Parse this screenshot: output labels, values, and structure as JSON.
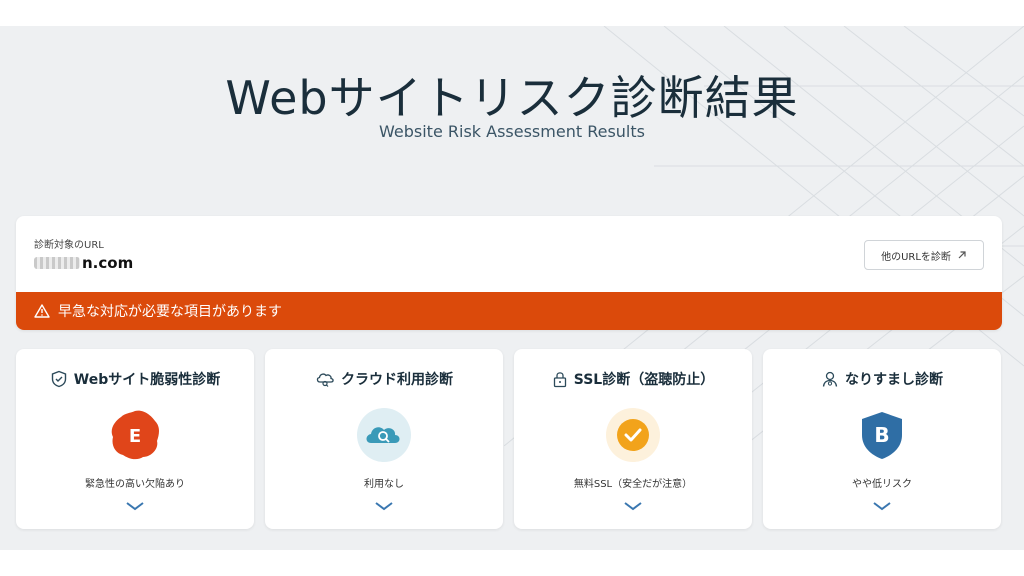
{
  "header": {
    "title": "Webサイトリスク診断結果",
    "subtitle": "Website Risk Assessment Results"
  },
  "target": {
    "label": "診断対象のURL",
    "url_visible": "n.com",
    "other_url_button": "他のURLを診断"
  },
  "alert": {
    "text": "早急な対応が必要な項目があります",
    "color": "#db4a0b"
  },
  "cards": [
    {
      "title": "Webサイト脆弱性診断",
      "icon": "shield-icon",
      "grade": "E",
      "status": "緊急性の高い欠陥あり",
      "grade_color": "#e0451a"
    },
    {
      "title": "クラウド利用診断",
      "icon": "cloud-search-icon",
      "grade": "",
      "status": "利用なし",
      "grade_color": "#3a9ab8"
    },
    {
      "title": "SSL診断（盗聴防止）",
      "icon": "lock-icon",
      "grade": "",
      "status": "無料SSL（安全だが注意）",
      "grade_color": "#f2a31b"
    },
    {
      "title": "なりすまし診断",
      "icon": "person-icon",
      "grade": "B",
      "status": "やや低リスク",
      "grade_color": "#2f6ea5"
    }
  ]
}
